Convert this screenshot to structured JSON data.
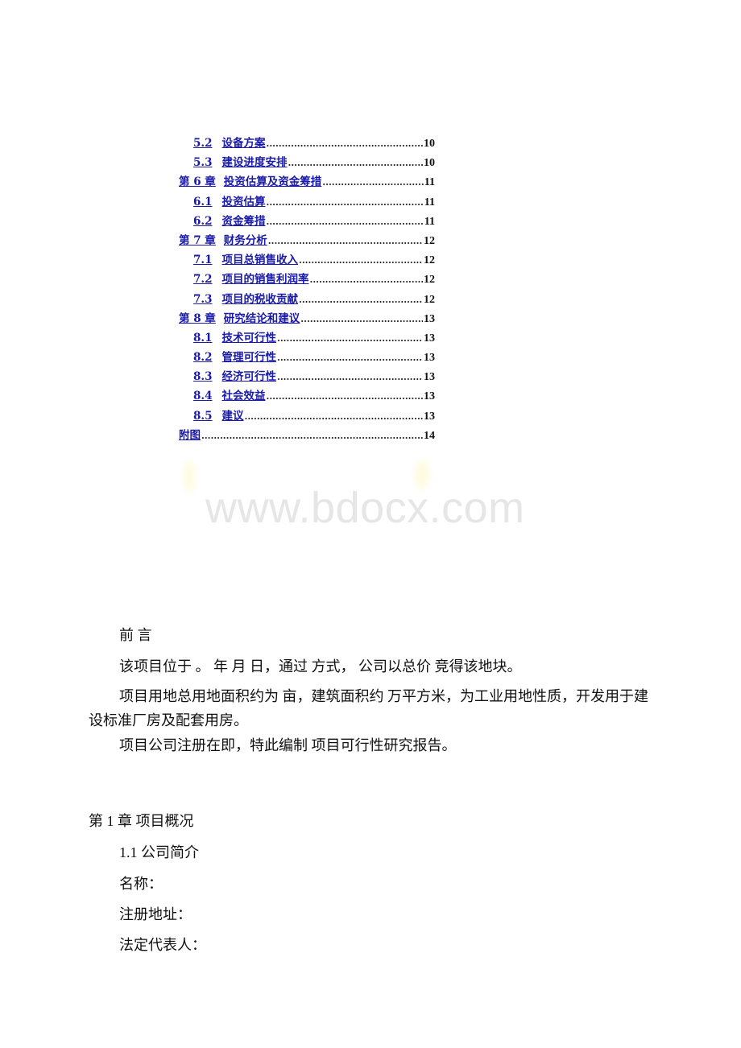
{
  "toc": {
    "entries": [
      {
        "level": 2,
        "number": "5.2",
        "title": "设备方案",
        "page": "10"
      },
      {
        "level": 2,
        "number": "5.3",
        "title": "建设进度安排",
        "page": "10"
      },
      {
        "level": 1,
        "number": "第 6 章",
        "title": "投资估算及资金筹措",
        "page": "11"
      },
      {
        "level": 2,
        "number": "6.1",
        "title": "投资估算",
        "page": "11"
      },
      {
        "level": 2,
        "number": "6.2",
        "title": "资金筹措",
        "page": "11"
      },
      {
        "level": 1,
        "number": "第 7 章",
        "title": "财务分析",
        "page": "12"
      },
      {
        "level": 2,
        "number": "7.1",
        "title": "项目总销售收入",
        "page": "12"
      },
      {
        "level": 2,
        "number": "7.2",
        "title": "项目的销售利润率",
        "page": "12"
      },
      {
        "level": 2,
        "number": "7.3",
        "title": "项目的税收贡献",
        "page": "12"
      },
      {
        "level": 1,
        "number": "第 8 章",
        "title": "研究结论和建议",
        "page": "13"
      },
      {
        "level": 2,
        "number": "8.1",
        "title": "技术可行性",
        "page": "13"
      },
      {
        "level": 2,
        "number": "8.2",
        "title": "管理可行性",
        "page": "13"
      },
      {
        "level": 2,
        "number": "8.3",
        "title": "经济可行性",
        "page": "13"
      },
      {
        "level": 2,
        "number": "8.4",
        "title": "社会效益",
        "page": "13"
      },
      {
        "level": 2,
        "number": "8.5",
        "title": "建议",
        "page": "13"
      },
      {
        "level": 1,
        "number": "",
        "title": "附图",
        "page": "14"
      }
    ]
  },
  "watermark": "www.bdocx.com",
  "preface": {
    "heading": "前 言",
    "p1": "该项目位于 。 年 月 日，通过 方式， 公司以总价 竞得该地块。",
    "p2": "项目用地总用地面积约为 亩，建筑面积约 万平方米，为工业用地性质，开发用于建设标准厂房及配套用房。",
    "p3": "项目公司注册在即，特此编制 项目可行性研究报告。"
  },
  "chapter1": {
    "heading": "第 1 章 项目概况",
    "section": "1.1 公司简介",
    "fields": [
      "名称：",
      "注册地址：",
      "法定代表人："
    ]
  }
}
